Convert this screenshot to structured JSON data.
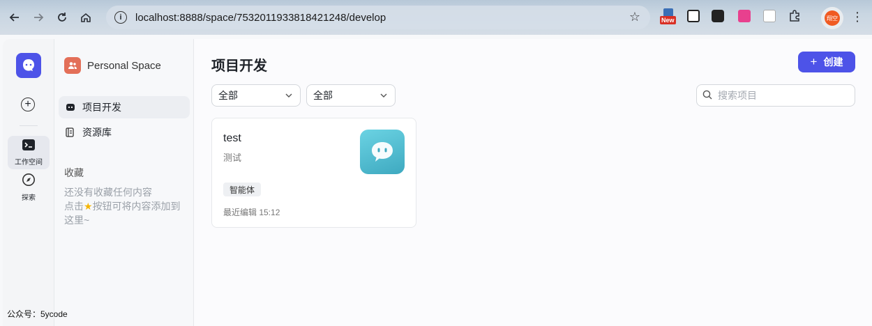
{
  "browser": {
    "url": "localhost:8888/space/7532011933818421248/develop",
    "avatar_text": "翔空",
    "extension_badge": "New"
  },
  "rail": {
    "items": [
      {
        "label": "工作空间",
        "icon": "terminal-icon"
      },
      {
        "label": "探索",
        "icon": "compass-icon"
      }
    ]
  },
  "sidebar": {
    "space_title": "Personal Space",
    "items": [
      {
        "label": "项目开发",
        "icon": "bot-icon"
      },
      {
        "label": "资源库",
        "icon": "library-icon"
      }
    ],
    "favorites_title": "收藏",
    "favorites_empty_line1": "还没有收藏任何内容",
    "favorites_empty_line2_before": "点击",
    "favorites_empty_line2_after": "按钮可将内容添加到",
    "favorites_empty_line3": "这里~"
  },
  "main": {
    "title": "项目开发",
    "create_label": "创建",
    "filter1": "全部",
    "filter2": "全部",
    "search_placeholder": "搜索项目"
  },
  "projects": [
    {
      "name": "test",
      "description": "测试",
      "tag": "智能体",
      "edited": "最近编辑 15:12"
    }
  ],
  "watermark": "公众号：5ycode",
  "colors": {
    "primary": "#4d53e8",
    "space_icon": "#e36f58",
    "thumb": "#4fbfd2"
  }
}
